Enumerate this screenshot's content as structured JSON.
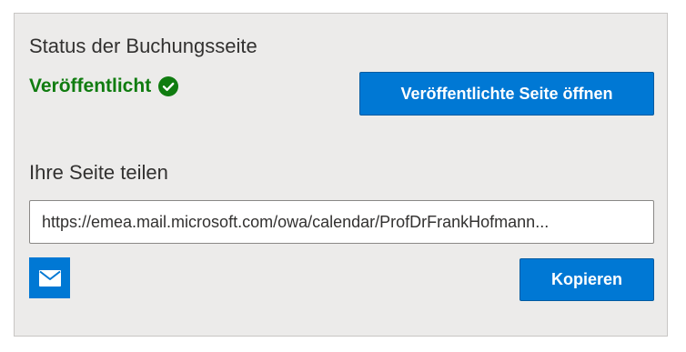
{
  "status_section": {
    "title": "Status der Buchungsseite",
    "status_text": "Veröffentlicht",
    "status_icon": "checkmark-circle-icon",
    "status_color": "#107c10",
    "open_button_label": "Veröffentlichte Seite öffnen"
  },
  "share_section": {
    "title": "Ihre Seite teilen",
    "url_value": "https://emea.mail.microsoft.com/owa/calendar/ProfDrFrankHofmann...",
    "email_icon": "mail-icon",
    "copy_button_label": "Kopieren"
  },
  "colors": {
    "accent": "#0078d4",
    "panel_background": "#ecebea",
    "success": "#107c10"
  }
}
